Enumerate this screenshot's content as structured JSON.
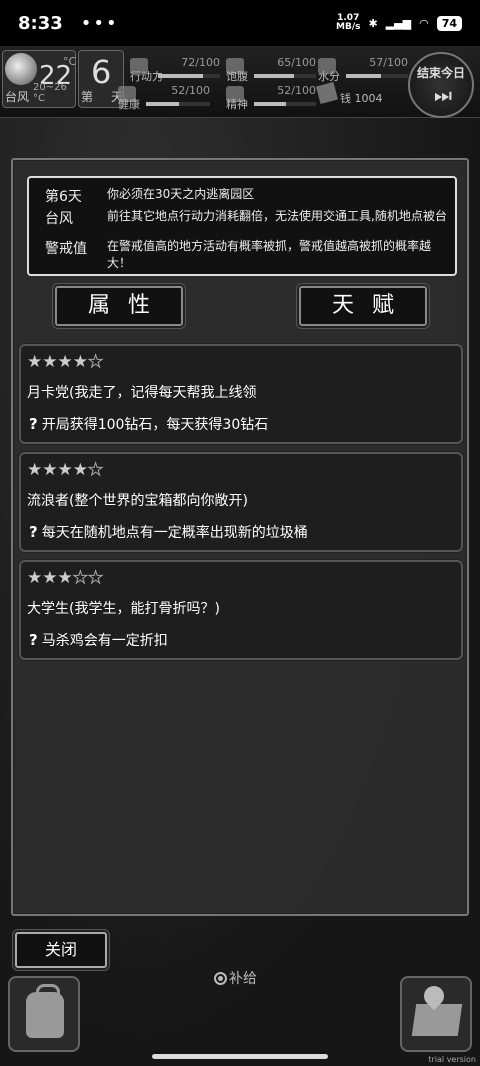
{
  "status": {
    "time": "8:33",
    "dots": "•••",
    "net_speed_value": "1.07",
    "net_speed_unit": "MB/s",
    "battery": "74"
  },
  "hud": {
    "weather_temp": "22",
    "weather_unit": "°C",
    "weather_name": "台风",
    "weather_range": "20~26 °C",
    "day_number": "6",
    "day_prefix": "第",
    "day_suffix": "天",
    "stats": [
      {
        "name": "行动力",
        "value": "72/100",
        "level": 0.72
      },
      {
        "name": "饱腹",
        "value": "65/100",
        "level": 0.65
      },
      {
        "name": "水分",
        "value": "57/100",
        "level": 0.57
      },
      {
        "name": "健康",
        "value": "52/100",
        "level": 0.52
      },
      {
        "name": "精神",
        "value": "52/100",
        "level": 0.52
      }
    ],
    "money": "钱 1004",
    "end_day_label": "结束今日",
    "end_day_icon": "⏭"
  },
  "info": {
    "day_key": "第6天",
    "day_text": "你必须在30天之内逃离园区",
    "typhoon_key": "台风",
    "typhoon_text": "前往其它地点行动力消耗翻倍，无法使用交通工具,随机地点被台",
    "alert_key": "警戒值",
    "alert_text": "在警戒值高的地方活动有概率被抓，警戒值越高被抓的概率越大！"
  },
  "tabs": {
    "attributes": "属性",
    "talents": "天赋"
  },
  "talents": [
    {
      "stars_on": "★★★★",
      "stars_off": "★",
      "rating": 4,
      "title": "月卡党(我走了，记得每天帮我上线领",
      "desc": "开局获得100钻石，每天获得30钻石"
    },
    {
      "stars_on": "★★★★",
      "stars_off": "★",
      "rating": 4,
      "title": "流浪者(整个世界的宝箱都向你敞开)",
      "desc": "每天在随机地点有一定概率出现新的垃圾桶"
    },
    {
      "stars_on": "★★★",
      "stars_off": "★★",
      "rating": 3,
      "title": "大学生(我学生，能打骨折吗？)",
      "desc": "马杀鸡会有一定折扣"
    }
  ],
  "question_mark": "?",
  "close_label": "关闭",
  "supply_label": "补给",
  "trial_label": "trial version"
}
